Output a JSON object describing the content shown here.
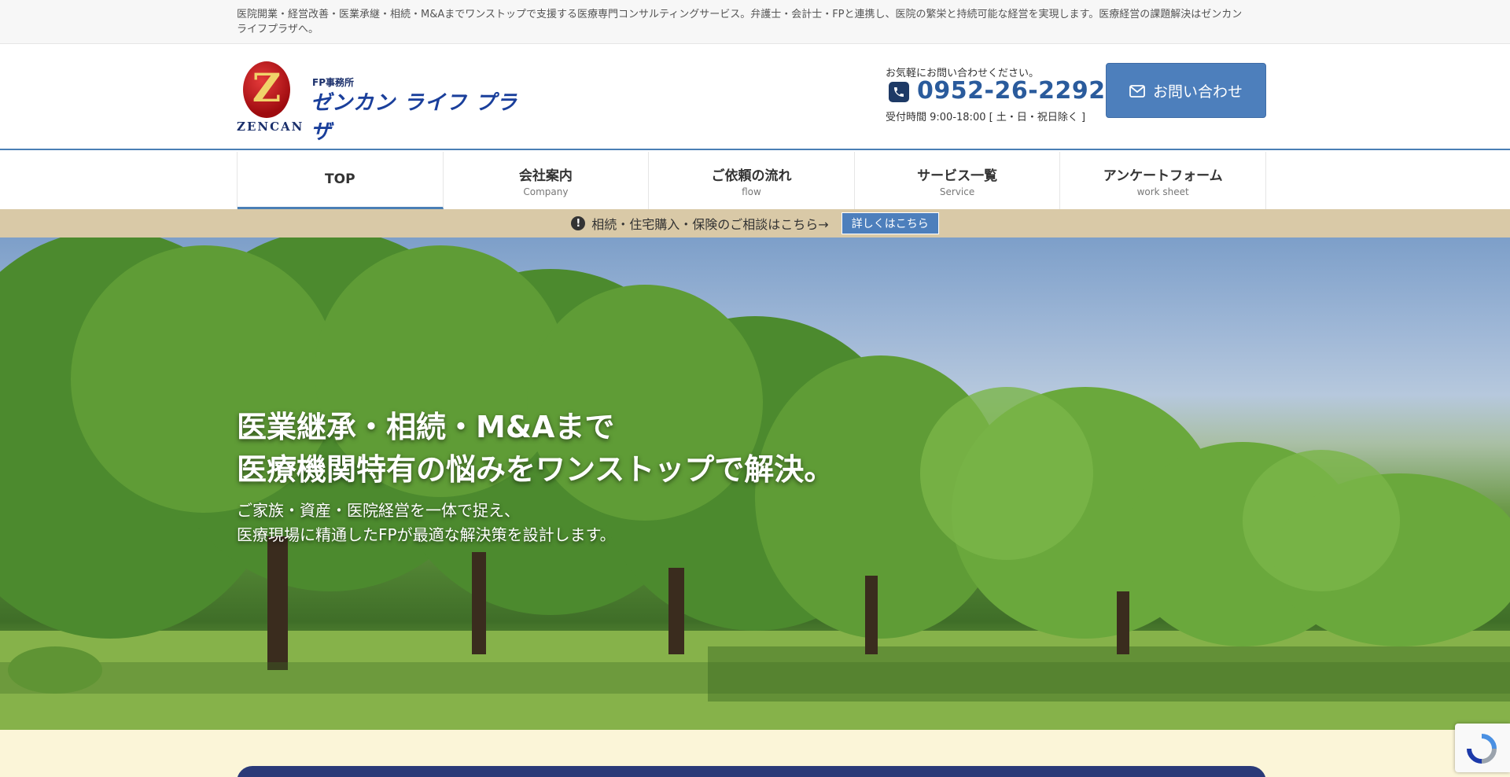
{
  "topbar": {
    "description": "医院開業・経営改善・医業承継・相続・M&Aまでワンストップで支援する医療専門コンサルティングサービス。弁護士・会計士・FPと連携し、医院の繁栄と持続可能な経営を実現します。医療経営の課題解決はゼンカンライフプラザへ。"
  },
  "logo": {
    "emblem_letter": "Z",
    "latin": "ZENCAN",
    "sub": "FP事務所",
    "main": "ゼンカン ライフ プラザ"
  },
  "contact": {
    "lead": "お気軽にお問い合わせください。",
    "phone": "0952-26-2292",
    "hours": "受付時間 9:00-18:00 [ 土・日・祝日除く ]",
    "phone_icon": "phone-icon",
    "button_label": "お問い合わせ",
    "button_icon": "mail-icon"
  },
  "nav": {
    "items": [
      {
        "label": "TOP",
        "sub": ""
      },
      {
        "label": "会社案内",
        "sub": "Company"
      },
      {
        "label": "ご依頼の流れ",
        "sub": "flow"
      },
      {
        "label": "サービス一覧",
        "sub": "Service"
      },
      {
        "label": "アンケートフォーム",
        "sub": "work sheet"
      }
    ],
    "active_index": 0
  },
  "notice": {
    "icon": "exclamation-icon",
    "icon_glyph": "!",
    "text": "相続・住宅購入・保険のご相談はこちら→",
    "button_label": "詳しくはこちら"
  },
  "hero": {
    "title_line1": "医業継承・相続・M&Aまで",
    "title_line2": "医療機関特有の悩みをワンストップで解決。",
    "sub_line1": "ご家族・資産・医院経営を一体で捉え、",
    "sub_line2": "医療現場に精通したFPが最適な解決策を設計します。"
  },
  "colors": {
    "accent": "#4d7fbc",
    "brand_navy": "#1a3f9b",
    "notice_bg": "#d9c9a7",
    "lower_bg": "#fbf5d8"
  }
}
